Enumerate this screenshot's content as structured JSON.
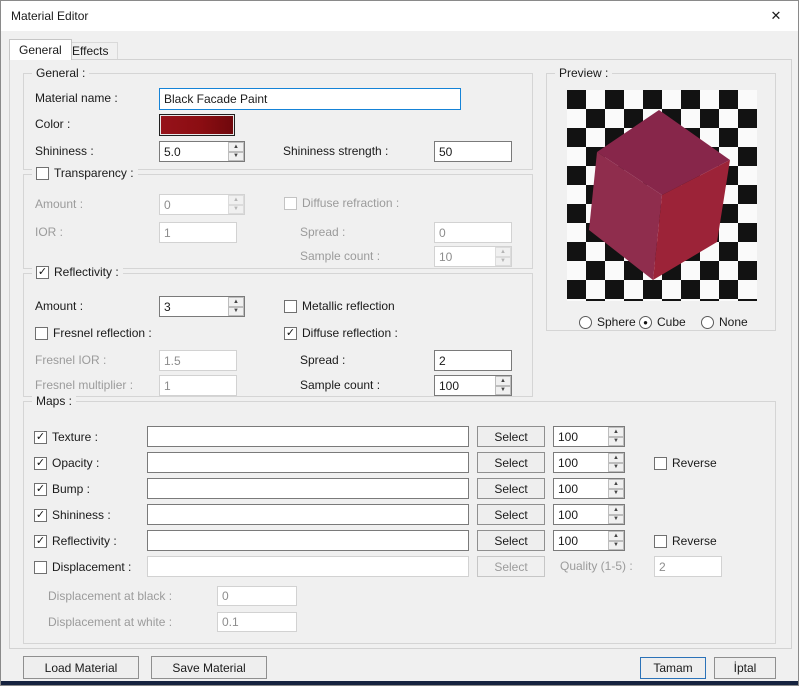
{
  "icons": {
    "close": "✕",
    "spin_up": "▲",
    "spin_down": "▼"
  },
  "window": {
    "title": "Material Editor"
  },
  "tabs": {
    "general": "General",
    "effects": "Effects"
  },
  "general": {
    "legend": "General :",
    "material_name": {
      "label": "Material name :",
      "value": "Black Facade Paint"
    },
    "color": {
      "label": "Color :",
      "value": "#8b0d12"
    },
    "shininess": {
      "label": "Shininess :",
      "value": "5.0"
    },
    "shininess_strength": {
      "label": "Shininess strength :",
      "value": "50"
    }
  },
  "transparency": {
    "legend": "Transparency :",
    "checked": "",
    "amount": {
      "label": "Amount :",
      "value": "0"
    },
    "ior": {
      "label": "IOR :",
      "value": "1"
    },
    "diffuse_refraction": {
      "label": "Diffuse refraction :",
      "checked": ""
    },
    "spread": {
      "label": "Spread :",
      "value": "0"
    },
    "sample_count": {
      "label": "Sample count :",
      "value": "10"
    }
  },
  "reflectivity": {
    "legend": "Reflectivity :",
    "checked": "✓",
    "amount": {
      "label": "Amount :",
      "value": "3"
    },
    "metallic": {
      "label": "Metallic reflection",
      "checked": ""
    },
    "fresnel": {
      "label": "Fresnel reflection :",
      "checked": ""
    },
    "diffuse": {
      "label": "Diffuse reflection :",
      "checked": "✓"
    },
    "fresnel_ior": {
      "label": "Fresnel IOR :",
      "value": "1.5"
    },
    "spread": {
      "label": "Spread :",
      "value": "2"
    },
    "fresnel_multiplier": {
      "label": "Fresnel multiplier :",
      "value": "1"
    },
    "sample_count": {
      "label": "Sample count :",
      "value": "100"
    }
  },
  "maps": {
    "legend": "Maps :",
    "select_label": "Select",
    "reverse_label": "Reverse",
    "rows": [
      {
        "label": "Texture :",
        "checked": "✓",
        "value": "",
        "amount": "100"
      },
      {
        "label": "Opacity :",
        "checked": "✓",
        "value": "",
        "amount": "100",
        "reverse": ""
      },
      {
        "label": "Bump :",
        "checked": "✓",
        "value": "",
        "amount": "100"
      },
      {
        "label": "Shininess :",
        "checked": "✓",
        "value": "",
        "amount": "100"
      },
      {
        "label": "Reflectivity :",
        "checked": "✓",
        "value": "",
        "amount": "100",
        "reverse": ""
      },
      {
        "label": "Displacement :",
        "checked": "",
        "value": ""
      }
    ],
    "quality": {
      "label": "Quality (1-5) :",
      "value": "2"
    },
    "disp_black": {
      "label": "Displacement at black :",
      "value": "0"
    },
    "disp_white": {
      "label": "Displacement at white :",
      "value": "0.1"
    }
  },
  "preview": {
    "legend": "Preview :",
    "options": [
      {
        "label": "Sphere",
        "mark": ""
      },
      {
        "label": "Cube",
        "mark": "●"
      },
      {
        "label": "None",
        "mark": ""
      }
    ],
    "cube": {
      "top": "#87264a",
      "left": "#8f2d4d",
      "right": "#9c2338"
    }
  },
  "footer": {
    "load": "Load Material",
    "save": "Save Material",
    "ok": "Tamam",
    "cancel": "İptal"
  }
}
